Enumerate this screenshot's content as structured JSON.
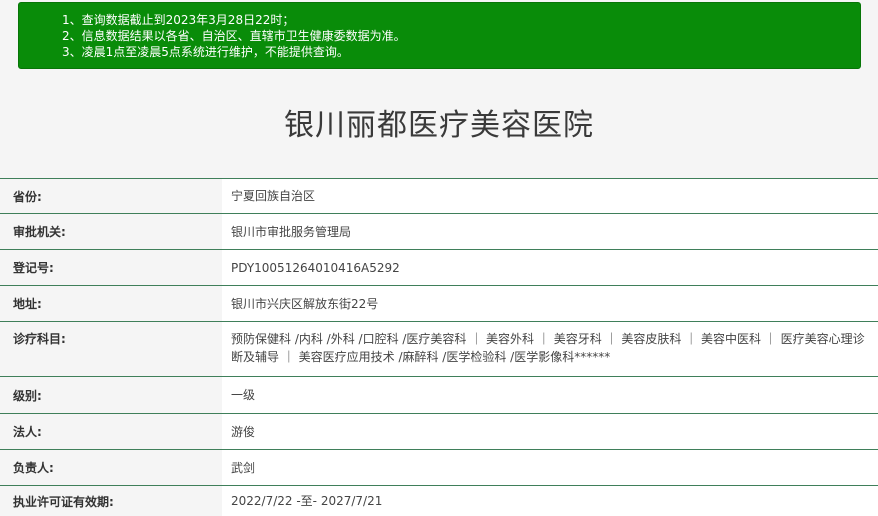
{
  "notice": {
    "lines": [
      "1、查询数据截止到2023年3月28日22时；",
      "2、信息数据结果以各省、自治区、直辖市卫生健康委数据为准。",
      "3、凌晨1点至凌晨5点系统进行维护，不能提供查询。"
    ]
  },
  "title": "银川丽都医疗美容医院",
  "rows": [
    {
      "label": "省份:",
      "value": "宁夏回族自治区"
    },
    {
      "label": "审批机关:",
      "value": "银川市审批服务管理局"
    },
    {
      "label": "登记号:",
      "value": "PDY10051264010416A5292"
    },
    {
      "label": "地址:",
      "value": "银川市兴庆区解放东街22号"
    },
    {
      "label": "诊疗科目:",
      "value": "预防保健科 /内科 /外科 /口腔科 /医疗美容科 ｜ 美容外科 ｜ 美容牙科 ｜ 美容皮肤科 ｜ 美容中医科 ｜ 医疗美容心理诊断及辅导 ｜ 美容医疗应用技术 /麻醉科 /医学检验科 /医学影像科******"
    },
    {
      "label": "级别:",
      "value": "一级"
    },
    {
      "label": "法人:",
      "value": "游俊"
    },
    {
      "label": "负责人:",
      "value": "武剑"
    },
    {
      "label": "执业许可证有效期:",
      "value": "2022/7/22 -至- 2027/7/21"
    }
  ],
  "colors": {
    "notice_bg": "#098c09",
    "border": "#3f7f5a"
  }
}
